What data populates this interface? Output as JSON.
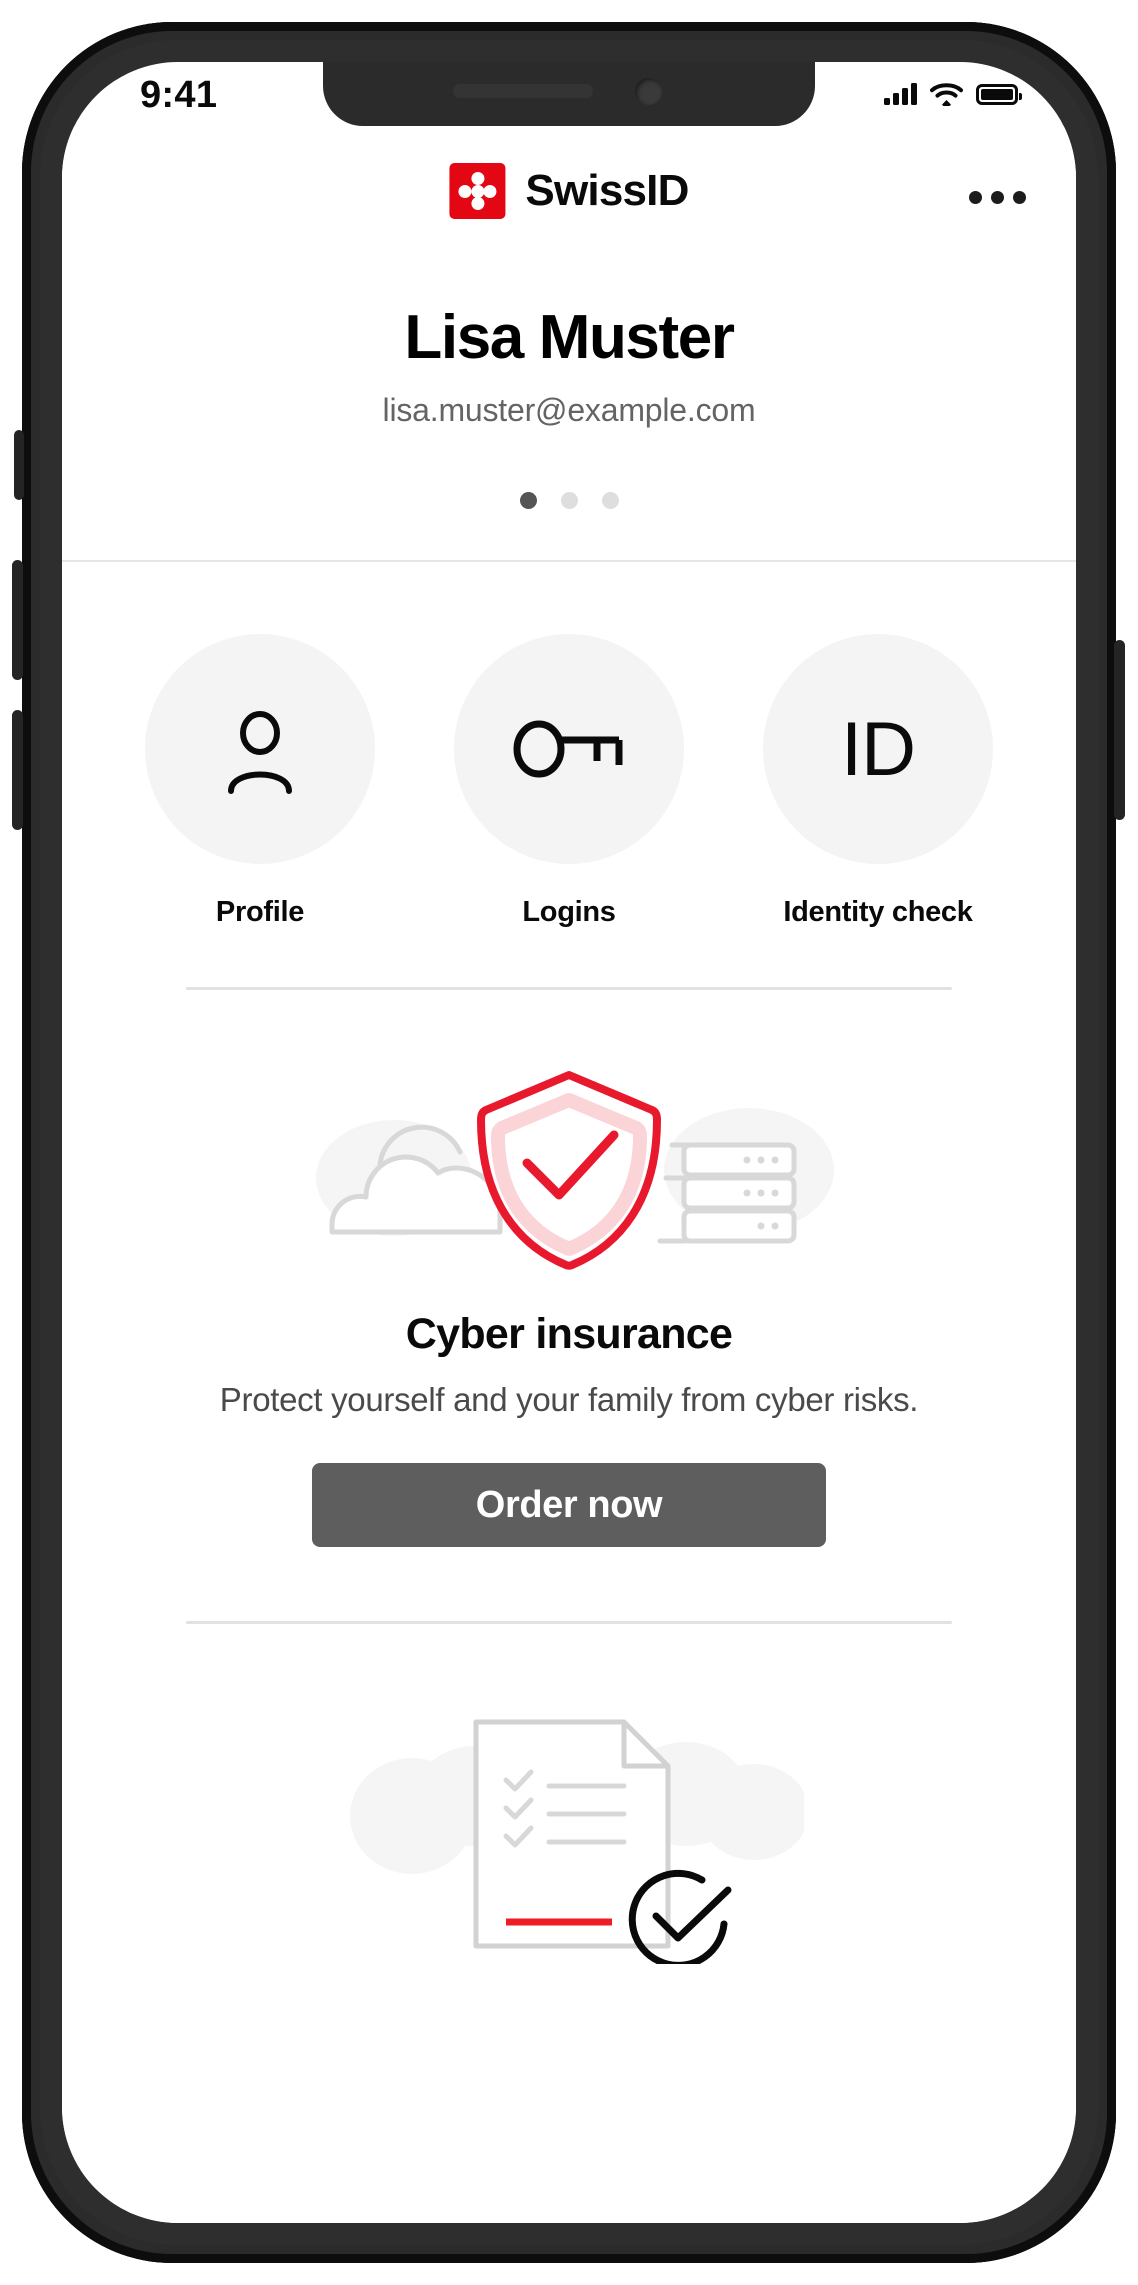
{
  "status_bar": {
    "time": "9:41",
    "signal_icon": "cellular-signal-icon",
    "wifi_icon": "wifi-icon",
    "battery_icon": "battery-full-icon"
  },
  "header": {
    "brand_name": "SwissID",
    "brand_mark": "swissid-logo-icon",
    "brand_color": "#E30613",
    "menu_icon": "more-options-icon"
  },
  "identity": {
    "name": "Lisa Muster",
    "email": "lisa.muster@example.com",
    "pager": {
      "total": 3,
      "active_index": 0
    }
  },
  "quick_actions": [
    {
      "label": "Profile",
      "icon": "person-icon"
    },
    {
      "label": "Logins",
      "icon": "key-icon"
    },
    {
      "label": "Identity check",
      "icon": "id-icon",
      "icon_text": "ID"
    }
  ],
  "promo": {
    "illustration": "shield-check-cloud-server-illustration",
    "title": "Cyber insurance",
    "subtitle": "Protect yourself and your family from cyber risks.",
    "cta_label": "Order now",
    "cta_color": "#5E5E5E",
    "accent_color": "#E8192C"
  },
  "promo_secondary": {
    "illustration": "document-checklist-verified-illustration"
  }
}
